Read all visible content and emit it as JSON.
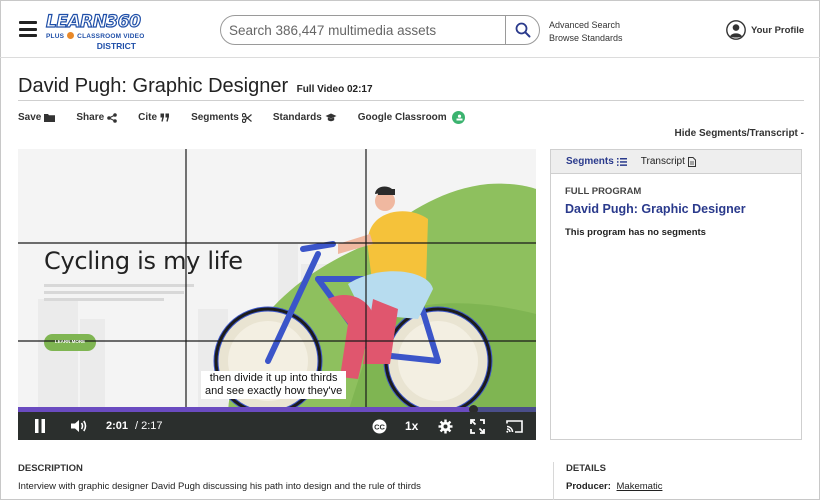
{
  "header": {
    "logo": {
      "top": "LEARN360",
      "mid_left": "PLUS",
      "mid_right": "CLASSROOM VIDEO",
      "bottom": "DISTRICT"
    },
    "search": {
      "placeholder": "Search 386,447 multimedia assets"
    },
    "advanced_search": "Advanced Search",
    "browse_standards": "Browse Standards",
    "profile_label": "Your Profile"
  },
  "page": {
    "title": "David Pugh: Graphic Designer",
    "subtitle": "Full Video 02:17"
  },
  "actions": {
    "save": "Save",
    "share": "Share",
    "cite": "Cite",
    "segments": "Segments",
    "standards": "Standards",
    "google_classroom": "Google Classroom"
  },
  "hide_link": "Hide Segments/Transcript -",
  "video": {
    "headline": "Cycling is my life",
    "button_text": "LEARN MORE",
    "caption_line1": "then divide it up into thirds",
    "caption_line2": "and see exactly how they've",
    "current_time": "2:01",
    "duration": "/ 2:17",
    "speed": "1x",
    "progress_fraction": 0.88,
    "colors": {
      "progress": "#6a4bc0",
      "controls_bg": "#2b2f2d",
      "hill": "#8ec05e"
    }
  },
  "panel": {
    "tab_segments": "Segments",
    "tab_transcript": "Transcript",
    "label": "FULL PROGRAM",
    "title": "David Pugh: Graphic Designer",
    "note": "This program has no segments"
  },
  "description": {
    "heading": "DESCRIPTION",
    "text": "Interview with graphic designer David Pugh discussing his path into design and the rule of thirds"
  },
  "details": {
    "heading": "DETAILS",
    "producer_label": "Producer:",
    "producer_value": "Makematic"
  },
  "icons": [
    "hamburger-icon",
    "search-icon",
    "user-avatar-icon",
    "folder-icon",
    "share-icon",
    "quote-icon",
    "scissors-icon",
    "mortarboard-icon",
    "google-classroom-icon",
    "list-icon",
    "document-icon",
    "play-pause-icon",
    "volume-icon",
    "closed-captions-icon",
    "settings-gear-icon",
    "fullscreen-icon",
    "cast-icon"
  ]
}
